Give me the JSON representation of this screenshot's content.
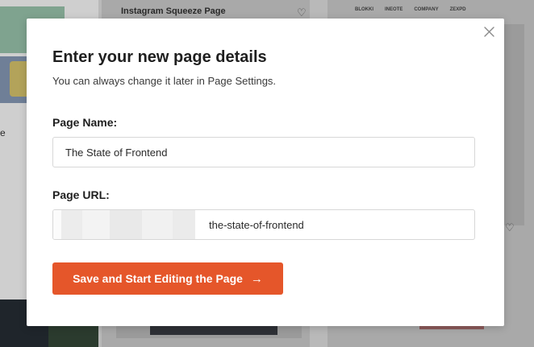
{
  "background": {
    "template_title": "Instagram Squeeze Page",
    "side_letter": "e",
    "logos": [
      "BLOKKI",
      "INEOTE",
      "COMPANY",
      "ZEXPD"
    ]
  },
  "modal": {
    "title": "Enter your new page details",
    "subtitle": "You can always change it later in Page Settings.",
    "page_name": {
      "label": "Page Name:",
      "value": "The State of Frontend"
    },
    "page_url": {
      "label": "Page URL:",
      "slug": "the-state-of-frontend"
    },
    "save_button": {
      "label": "Save and Start Editing the Page",
      "icon": "arrow-right-icon"
    },
    "close_icon": "close-icon"
  },
  "colors": {
    "accent": "#e5562a",
    "overlay": "#b9b9b9"
  }
}
